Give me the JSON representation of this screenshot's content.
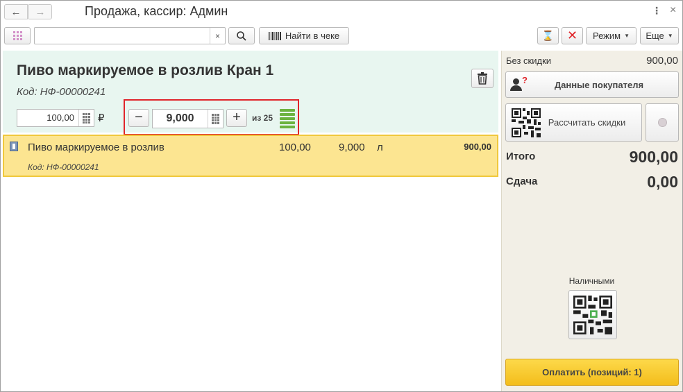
{
  "window": {
    "title": "Продажа, кассир: Админ"
  },
  "toolbar": {
    "search_value": "",
    "find_in_receipt_label": "Найти в чеке",
    "mode_label": "Режим",
    "more_label": "Еще"
  },
  "product": {
    "title": "Пиво маркируемое в розлив Кран 1",
    "code": "Код: НФ-00000241",
    "price": "100,00",
    "currency": "₽",
    "quantity": "9,000",
    "of_stock": "из 25",
    "stock_level_fraction": 0.36
  },
  "receipt": {
    "rows": [
      {
        "name": "Пиво маркируемое в розлив",
        "code": "Код: НФ-00000241",
        "price": "100,00",
        "quantity": "9,000",
        "unit": "л",
        "sum": "900,00"
      }
    ]
  },
  "summary": {
    "no_discount_label": "Без скидки",
    "no_discount_value": "900,00",
    "buyer_data_label": "Данные покупателя",
    "calc_discounts_label": "Рассчитать скидки",
    "total_label": "Итого",
    "total_value": "900,00",
    "change_label": "Сдача",
    "change_value": "0,00",
    "cash_label": "Наличными",
    "pay_label": "Оплатить (позиций: 1)"
  },
  "colors": {
    "accent_yellow": "#f3bd1b",
    "highlight_red": "#e0252a",
    "product_panel_bg": "#e8f6f0",
    "row_bg": "#fce591",
    "stock_green": "#6cb33f"
  }
}
